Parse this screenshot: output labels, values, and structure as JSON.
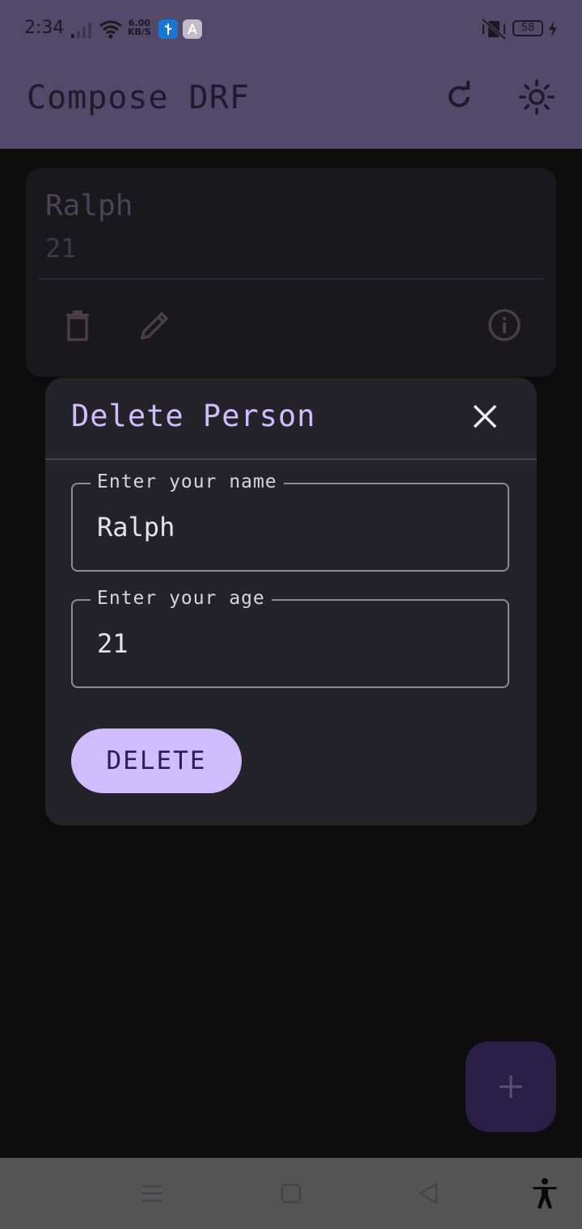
{
  "status_bar": {
    "time": "2:34",
    "net_speed_value": "6.00",
    "net_speed_unit": "KB/S",
    "battery": "58"
  },
  "app_bar": {
    "title": "Compose DRF",
    "refresh_icon": "refresh-icon",
    "theme_icon": "sun-icon"
  },
  "person_card": {
    "name": "Ralph",
    "age": "21",
    "actions": [
      "delete-icon",
      "edit-icon",
      "info-icon"
    ]
  },
  "dialog": {
    "title": "Delete Person",
    "close_icon": "close-icon",
    "name_field": {
      "label": "Enter your name",
      "value": "Ralph"
    },
    "age_field": {
      "label": "Enter your age",
      "value": "21"
    },
    "delete_button": "DELETE"
  },
  "fab": {
    "icon": "plus-icon"
  },
  "nav_bar": {
    "icons": [
      "menu-icon",
      "home-icon",
      "back-icon",
      "accessibility-icon"
    ]
  },
  "colors": {
    "app_bar": "#53496a",
    "dialog_title": "#cfbdfe",
    "delete_button": "#cfbcfc",
    "fab": "#2a1f47"
  }
}
